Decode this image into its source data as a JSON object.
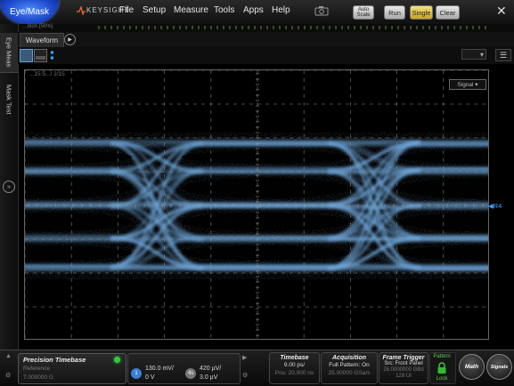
{
  "menubar": {
    "eyemask_label": "Eye/Mask",
    "brand": "KEYSIGHT",
    "items": [
      "File",
      "Setup",
      "Measure",
      "Tools",
      "Apps",
      "Help"
    ],
    "buttons": {
      "autoscale": "Auto Scale",
      "run": "Run",
      "single": "Single",
      "clear": "Clear"
    },
    "close": "✕"
  },
  "status_strip": {
    "text": "...ition   (50%)"
  },
  "left_tabs": {
    "eye_meas": "Eye Meas",
    "mask_test": "Mask Test",
    "expand": "»"
  },
  "waveform": {
    "tab_label": "Waveform",
    "plot_label": "...15:5.../ 2/15",
    "signal_select": "Signal ▾",
    "ref_marker": "◀R4",
    "dropdown": "▾",
    "menu": "☰"
  },
  "bottom": {
    "timebase_panel": {
      "title": "Precision Timebase",
      "line2": "Reference",
      "line3": "7.000000 G"
    },
    "ch1": {
      "label": "1",
      "line1": "130.0 mV/",
      "line2": "0 V"
    },
    "ch2": {
      "label": "4s",
      "line1": "420 µV/",
      "line2": "3.0 µV"
    },
    "timebase": {
      "title": "Timebase",
      "l1": "9.00 ps/",
      "l2": "Pos: 20.000 ns"
    },
    "acquisition": {
      "title": "Acquisition",
      "l1": "Full Pattern: On",
      "l2": "25.00000 GSa/s"
    },
    "frame_trigger": {
      "title": "Frame Trigger",
      "l1": "Src: Front Panel",
      "l2": "26.0000000 GBd",
      "l3": "128 UI"
    },
    "lock": {
      "l1": "Pattern",
      "l2": "Lock"
    },
    "math_button": "Math",
    "signals_button": "Signals"
  },
  "chart_data": {
    "type": "eye-diagram",
    "grid": true,
    "title": "",
    "xlabel": "",
    "ylabel": ""
  },
  "colors": {
    "trace": "#6fa8dc",
    "accent": "#1a46c8",
    "ref": "#3ca0ff",
    "led": "#2ecc40"
  }
}
